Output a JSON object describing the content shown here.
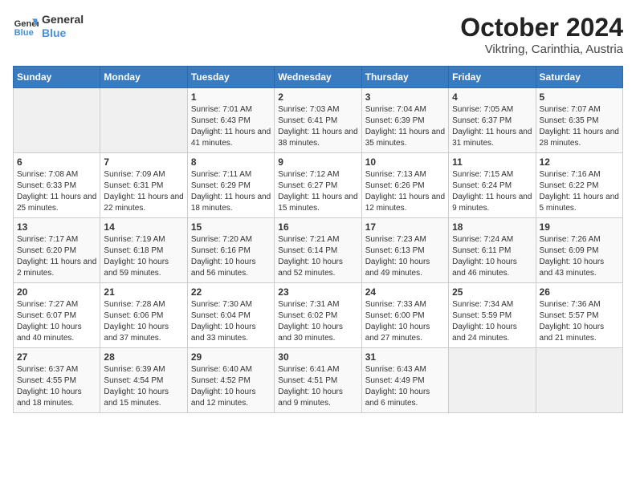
{
  "logo": {
    "line1": "General",
    "line2": "Blue"
  },
  "title": "October 2024",
  "subtitle": "Viktring, Carinthia, Austria",
  "weekdays": [
    "Sunday",
    "Monday",
    "Tuesday",
    "Wednesday",
    "Thursday",
    "Friday",
    "Saturday"
  ],
  "weeks": [
    [
      {
        "day": "",
        "detail": ""
      },
      {
        "day": "",
        "detail": ""
      },
      {
        "day": "1",
        "detail": "Sunrise: 7:01 AM\nSunset: 6:43 PM\nDaylight: 11 hours and 41 minutes."
      },
      {
        "day": "2",
        "detail": "Sunrise: 7:03 AM\nSunset: 6:41 PM\nDaylight: 11 hours and 38 minutes."
      },
      {
        "day": "3",
        "detail": "Sunrise: 7:04 AM\nSunset: 6:39 PM\nDaylight: 11 hours and 35 minutes."
      },
      {
        "day": "4",
        "detail": "Sunrise: 7:05 AM\nSunset: 6:37 PM\nDaylight: 11 hours and 31 minutes."
      },
      {
        "day": "5",
        "detail": "Sunrise: 7:07 AM\nSunset: 6:35 PM\nDaylight: 11 hours and 28 minutes."
      }
    ],
    [
      {
        "day": "6",
        "detail": "Sunrise: 7:08 AM\nSunset: 6:33 PM\nDaylight: 11 hours and 25 minutes."
      },
      {
        "day": "7",
        "detail": "Sunrise: 7:09 AM\nSunset: 6:31 PM\nDaylight: 11 hours and 22 minutes."
      },
      {
        "day": "8",
        "detail": "Sunrise: 7:11 AM\nSunset: 6:29 PM\nDaylight: 11 hours and 18 minutes."
      },
      {
        "day": "9",
        "detail": "Sunrise: 7:12 AM\nSunset: 6:27 PM\nDaylight: 11 hours and 15 minutes."
      },
      {
        "day": "10",
        "detail": "Sunrise: 7:13 AM\nSunset: 6:26 PM\nDaylight: 11 hours and 12 minutes."
      },
      {
        "day": "11",
        "detail": "Sunrise: 7:15 AM\nSunset: 6:24 PM\nDaylight: 11 hours and 9 minutes."
      },
      {
        "day": "12",
        "detail": "Sunrise: 7:16 AM\nSunset: 6:22 PM\nDaylight: 11 hours and 5 minutes."
      }
    ],
    [
      {
        "day": "13",
        "detail": "Sunrise: 7:17 AM\nSunset: 6:20 PM\nDaylight: 11 hours and 2 minutes."
      },
      {
        "day": "14",
        "detail": "Sunrise: 7:19 AM\nSunset: 6:18 PM\nDaylight: 10 hours and 59 minutes."
      },
      {
        "day": "15",
        "detail": "Sunrise: 7:20 AM\nSunset: 6:16 PM\nDaylight: 10 hours and 56 minutes."
      },
      {
        "day": "16",
        "detail": "Sunrise: 7:21 AM\nSunset: 6:14 PM\nDaylight: 10 hours and 52 minutes."
      },
      {
        "day": "17",
        "detail": "Sunrise: 7:23 AM\nSunset: 6:13 PM\nDaylight: 10 hours and 49 minutes."
      },
      {
        "day": "18",
        "detail": "Sunrise: 7:24 AM\nSunset: 6:11 PM\nDaylight: 10 hours and 46 minutes."
      },
      {
        "day": "19",
        "detail": "Sunrise: 7:26 AM\nSunset: 6:09 PM\nDaylight: 10 hours and 43 minutes."
      }
    ],
    [
      {
        "day": "20",
        "detail": "Sunrise: 7:27 AM\nSunset: 6:07 PM\nDaylight: 10 hours and 40 minutes."
      },
      {
        "day": "21",
        "detail": "Sunrise: 7:28 AM\nSunset: 6:06 PM\nDaylight: 10 hours and 37 minutes."
      },
      {
        "day": "22",
        "detail": "Sunrise: 7:30 AM\nSunset: 6:04 PM\nDaylight: 10 hours and 33 minutes."
      },
      {
        "day": "23",
        "detail": "Sunrise: 7:31 AM\nSunset: 6:02 PM\nDaylight: 10 hours and 30 minutes."
      },
      {
        "day": "24",
        "detail": "Sunrise: 7:33 AM\nSunset: 6:00 PM\nDaylight: 10 hours and 27 minutes."
      },
      {
        "day": "25",
        "detail": "Sunrise: 7:34 AM\nSunset: 5:59 PM\nDaylight: 10 hours and 24 minutes."
      },
      {
        "day": "26",
        "detail": "Sunrise: 7:36 AM\nSunset: 5:57 PM\nDaylight: 10 hours and 21 minutes."
      }
    ],
    [
      {
        "day": "27",
        "detail": "Sunrise: 6:37 AM\nSunset: 4:55 PM\nDaylight: 10 hours and 18 minutes."
      },
      {
        "day": "28",
        "detail": "Sunrise: 6:39 AM\nSunset: 4:54 PM\nDaylight: 10 hours and 15 minutes."
      },
      {
        "day": "29",
        "detail": "Sunrise: 6:40 AM\nSunset: 4:52 PM\nDaylight: 10 hours and 12 minutes."
      },
      {
        "day": "30",
        "detail": "Sunrise: 6:41 AM\nSunset: 4:51 PM\nDaylight: 10 hours and 9 minutes."
      },
      {
        "day": "31",
        "detail": "Sunrise: 6:43 AM\nSunset: 4:49 PM\nDaylight: 10 hours and 6 minutes."
      },
      {
        "day": "",
        "detail": ""
      },
      {
        "day": "",
        "detail": ""
      }
    ]
  ]
}
